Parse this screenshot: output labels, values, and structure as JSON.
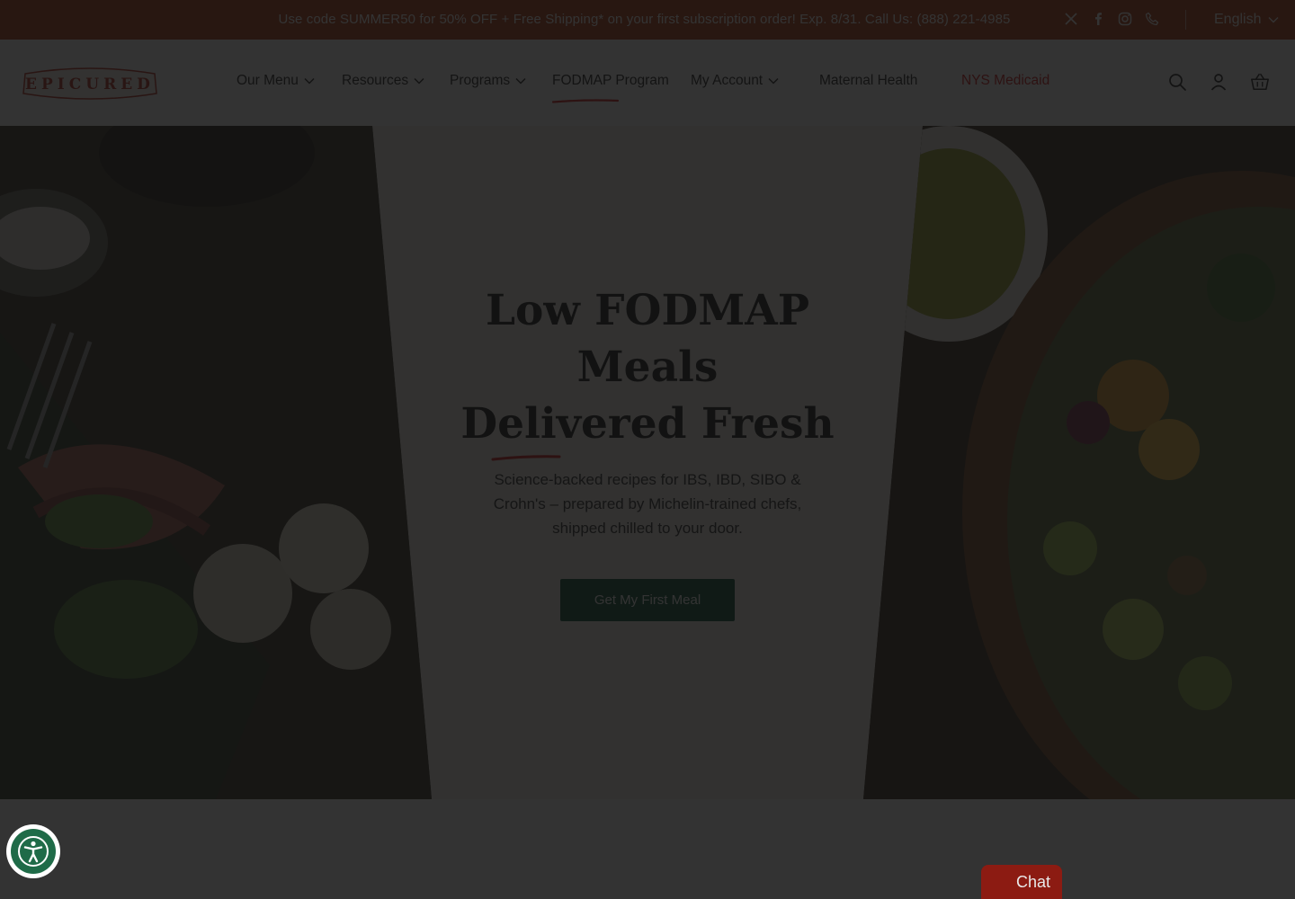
{
  "announcement": {
    "text": "Use code SUMMER50 for 50% OFF + Free Shipping* on your first subscription order! Exp. 8/31. Call Us: (888) 221-4985",
    "social_icons": [
      "x-icon",
      "facebook-icon",
      "instagram-icon",
      "phone-icon"
    ],
    "language": "English"
  },
  "header": {
    "logo_text": "EPICURED",
    "nav": [
      {
        "label": "Our Menu",
        "dropdown": true
      },
      {
        "label": "Resources",
        "dropdown": true
      },
      {
        "label": "Programs",
        "dropdown": true
      },
      {
        "label": "FODMAP Program",
        "dropdown": false,
        "active": true
      },
      {
        "label": "My Account",
        "dropdown": true
      },
      {
        "label": "Maternal Health",
        "dropdown": false
      },
      {
        "label": "NYS Medicaid",
        "dropdown": false,
        "highlight": true
      }
    ],
    "icons": [
      "search-icon",
      "account-icon",
      "cart-icon"
    ]
  },
  "hero": {
    "title_line1": "Low FODMAP",
    "title_line2": "Meals",
    "title_line3": "Delivered Fresh",
    "subtitle": "Science-backed recipes for IBS, IBD, SIBO & Crohn's – prepared by Michelin-trained chefs, shipped chilled to your door.",
    "cta_label": "Get My First Meal"
  },
  "widgets": {
    "accessibility_icon": "accessibility-icon",
    "chat_label": "Chat"
  },
  "colors": {
    "announcement_bg": "#b23a12",
    "brand_red": "#d6191b",
    "cta_green": "#0c5234",
    "overlay": "rgba(18,18,18,0.86)"
  }
}
